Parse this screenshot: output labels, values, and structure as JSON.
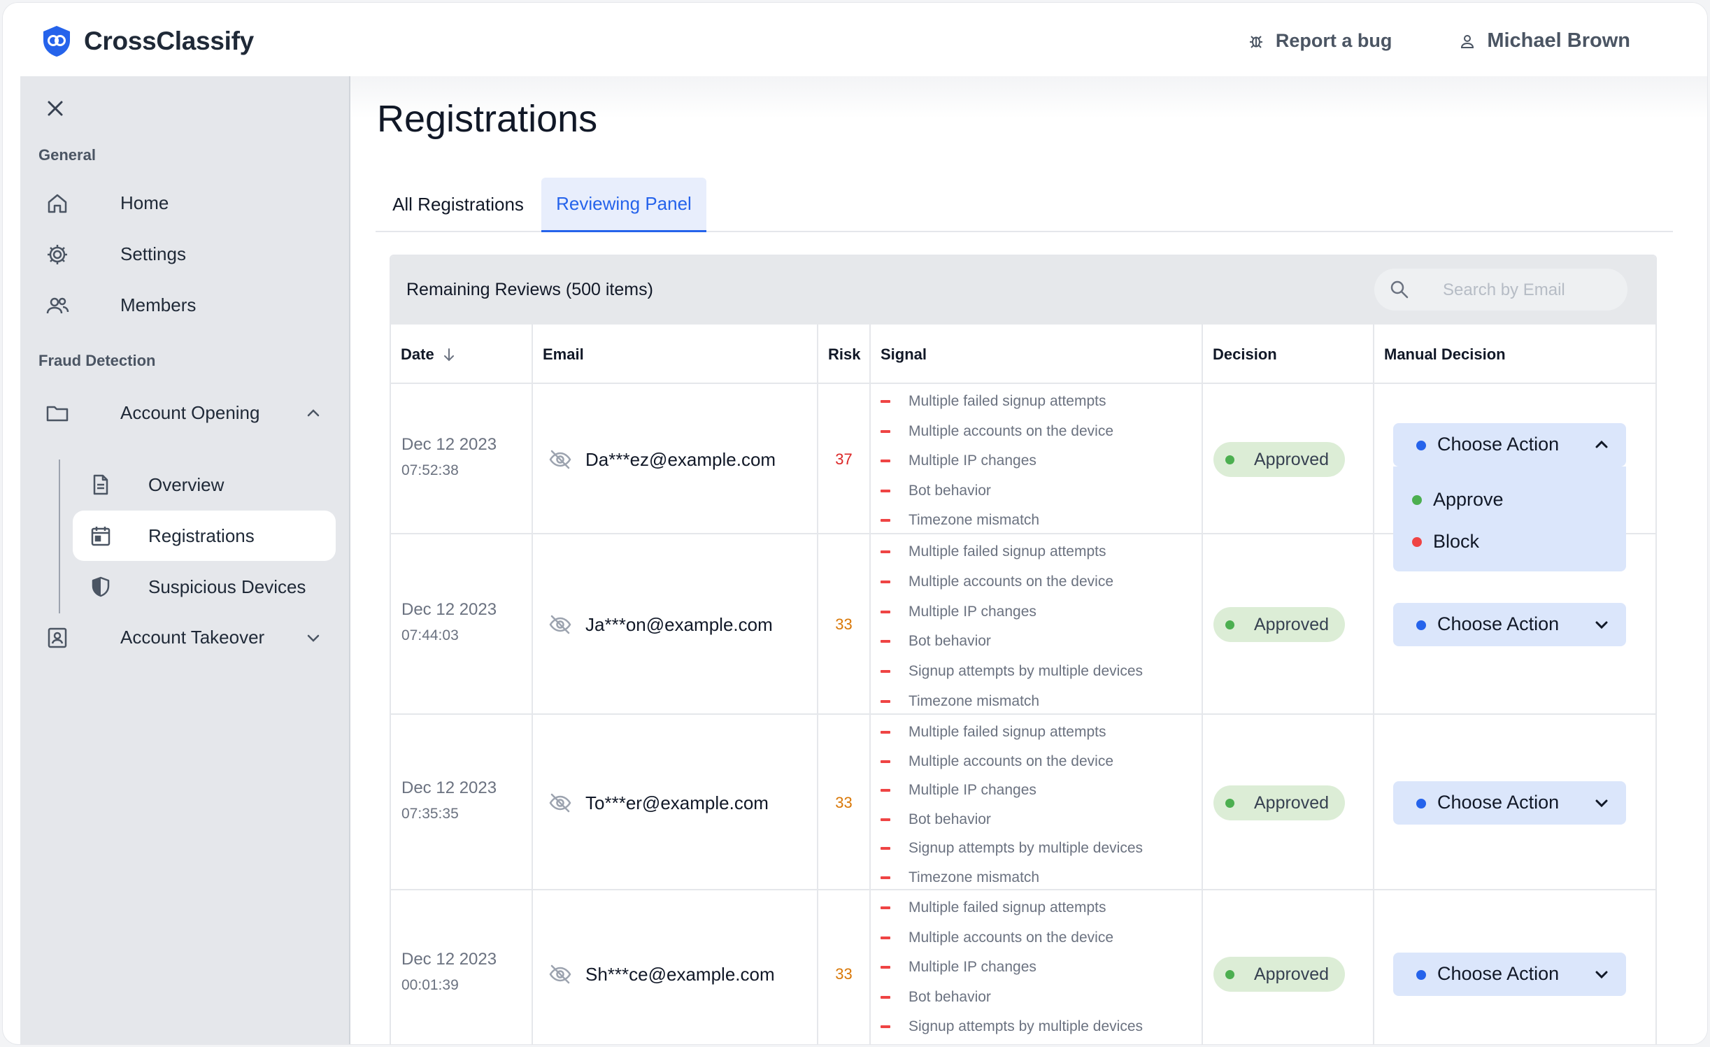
{
  "app": {
    "brand": "CrossClassify",
    "report_bug": "Report a bug",
    "user_name": "Michael Brown"
  },
  "sidebar": {
    "general_label": "General",
    "fraud_label": "Fraud Detection",
    "items": [
      {
        "label": "Home",
        "icon": "home-icon"
      },
      {
        "label": "Settings",
        "icon": "gear-icon"
      },
      {
        "label": "Members",
        "icon": "users-icon"
      }
    ],
    "account_opening": {
      "label": "Account Opening",
      "icon": "folder-icon",
      "expanded": true
    },
    "sub_items": [
      {
        "label": "Overview",
        "icon": "document-icon"
      },
      {
        "label": "Registrations",
        "icon": "calendar-icon",
        "active": true
      },
      {
        "label": "Suspicious Devices",
        "icon": "shield-icon"
      }
    ],
    "account_takeover": {
      "label": "Account Takeover",
      "icon": "id-card-icon",
      "expanded": false
    }
  },
  "main": {
    "title": "Registrations",
    "tabs": [
      {
        "label": "All Registrations",
        "active": false
      },
      {
        "label": "Reviewing Panel",
        "active": true
      }
    ],
    "remaining": "Remaining Reviews (500 items)",
    "search_placeholder": "Search by Email",
    "columns": [
      "Date",
      "Email",
      "Risk",
      "Signal",
      "Decision",
      "Manual Decision"
    ],
    "rows": [
      {
        "date": "Dec 12 2023",
        "time": "07:52:38",
        "email": "Da***ez@example.com",
        "risk": "37",
        "risk_color": "#dc2626",
        "signals": [
          "Multiple failed signup attempts",
          "Multiple accounts on the device",
          "Multiple IP changes",
          "Bot behavior",
          "Timezone mismatch"
        ],
        "decision": "Approved",
        "action": "Choose Action",
        "open": true
      },
      {
        "date": "Dec 12 2023",
        "time": "07:44:03",
        "email": "Ja***on@example.com",
        "risk": "33",
        "risk_color": "#d97706",
        "signals": [
          "Multiple failed signup attempts",
          "Multiple accounts on the device",
          "Multiple IP changes",
          "Bot behavior",
          "Signup attempts by multiple devices",
          "Timezone mismatch"
        ],
        "decision": "Approved",
        "action": "Choose Action",
        "open": false
      },
      {
        "date": "Dec 12 2023",
        "time": "07:35:35",
        "email": "To***er@example.com",
        "risk": "33",
        "risk_color": "#d97706",
        "signals": [
          "Multiple failed signup attempts",
          "Multiple accounts on the device",
          "Multiple IP changes",
          "Bot behavior",
          "Signup attempts by multiple devices",
          "Timezone mismatch"
        ],
        "decision": "Approved",
        "action": "Choose Action",
        "open": false
      },
      {
        "date": "Dec 12 2023",
        "time": "00:01:39",
        "email": "Sh***ce@example.com",
        "risk": "33",
        "risk_color": "#d97706",
        "signals": [
          "Multiple failed signup attempts",
          "Multiple accounts on the device",
          "Multiple IP changes",
          "Bot behavior",
          "Signup attempts by multiple devices"
        ],
        "decision": "Approved",
        "action": "Choose Action",
        "open": false
      }
    ],
    "dropdown_options": [
      {
        "label": "Approve",
        "color": "#4caf50"
      },
      {
        "label": "Block",
        "color": "#ef4444"
      }
    ]
  }
}
